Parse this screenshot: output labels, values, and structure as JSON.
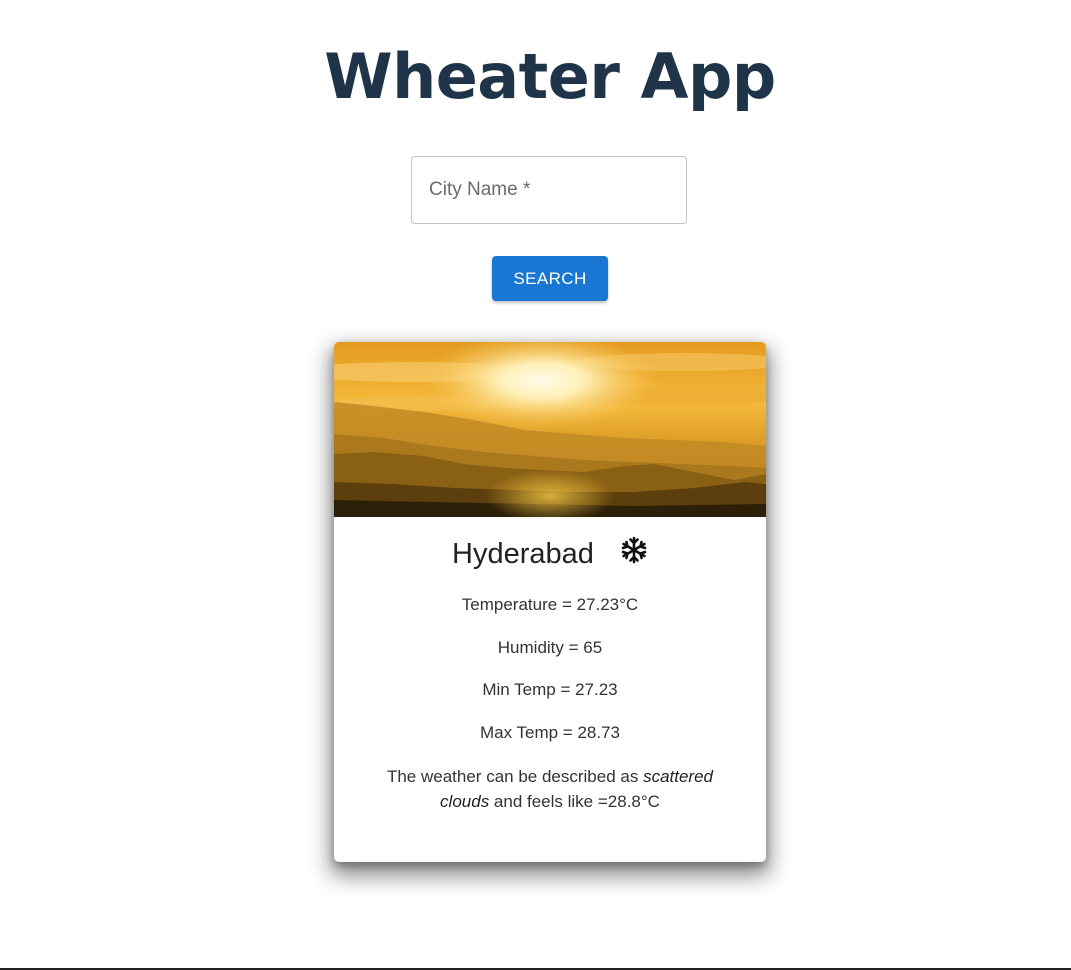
{
  "header": {
    "title": "Wheater App"
  },
  "search": {
    "label": "City Name *",
    "value": "",
    "button_label": "SEARCH"
  },
  "card": {
    "image": "sunset-over-mountains",
    "city": "Hyderabad",
    "weather_icon": "snowflake-icon",
    "temperature": "Temperature = 27.23°C",
    "humidity": "Humidity = 65",
    "min_temp": "Min Temp = 27.23",
    "max_temp": "Max Temp = 28.73",
    "description_prefix": "The weather can be described as ",
    "description_condition": "scattered clouds",
    "description_suffix": " and feels like =28.8°C"
  },
  "colors": {
    "title": "#1f3448",
    "primary": "#1976d2"
  }
}
